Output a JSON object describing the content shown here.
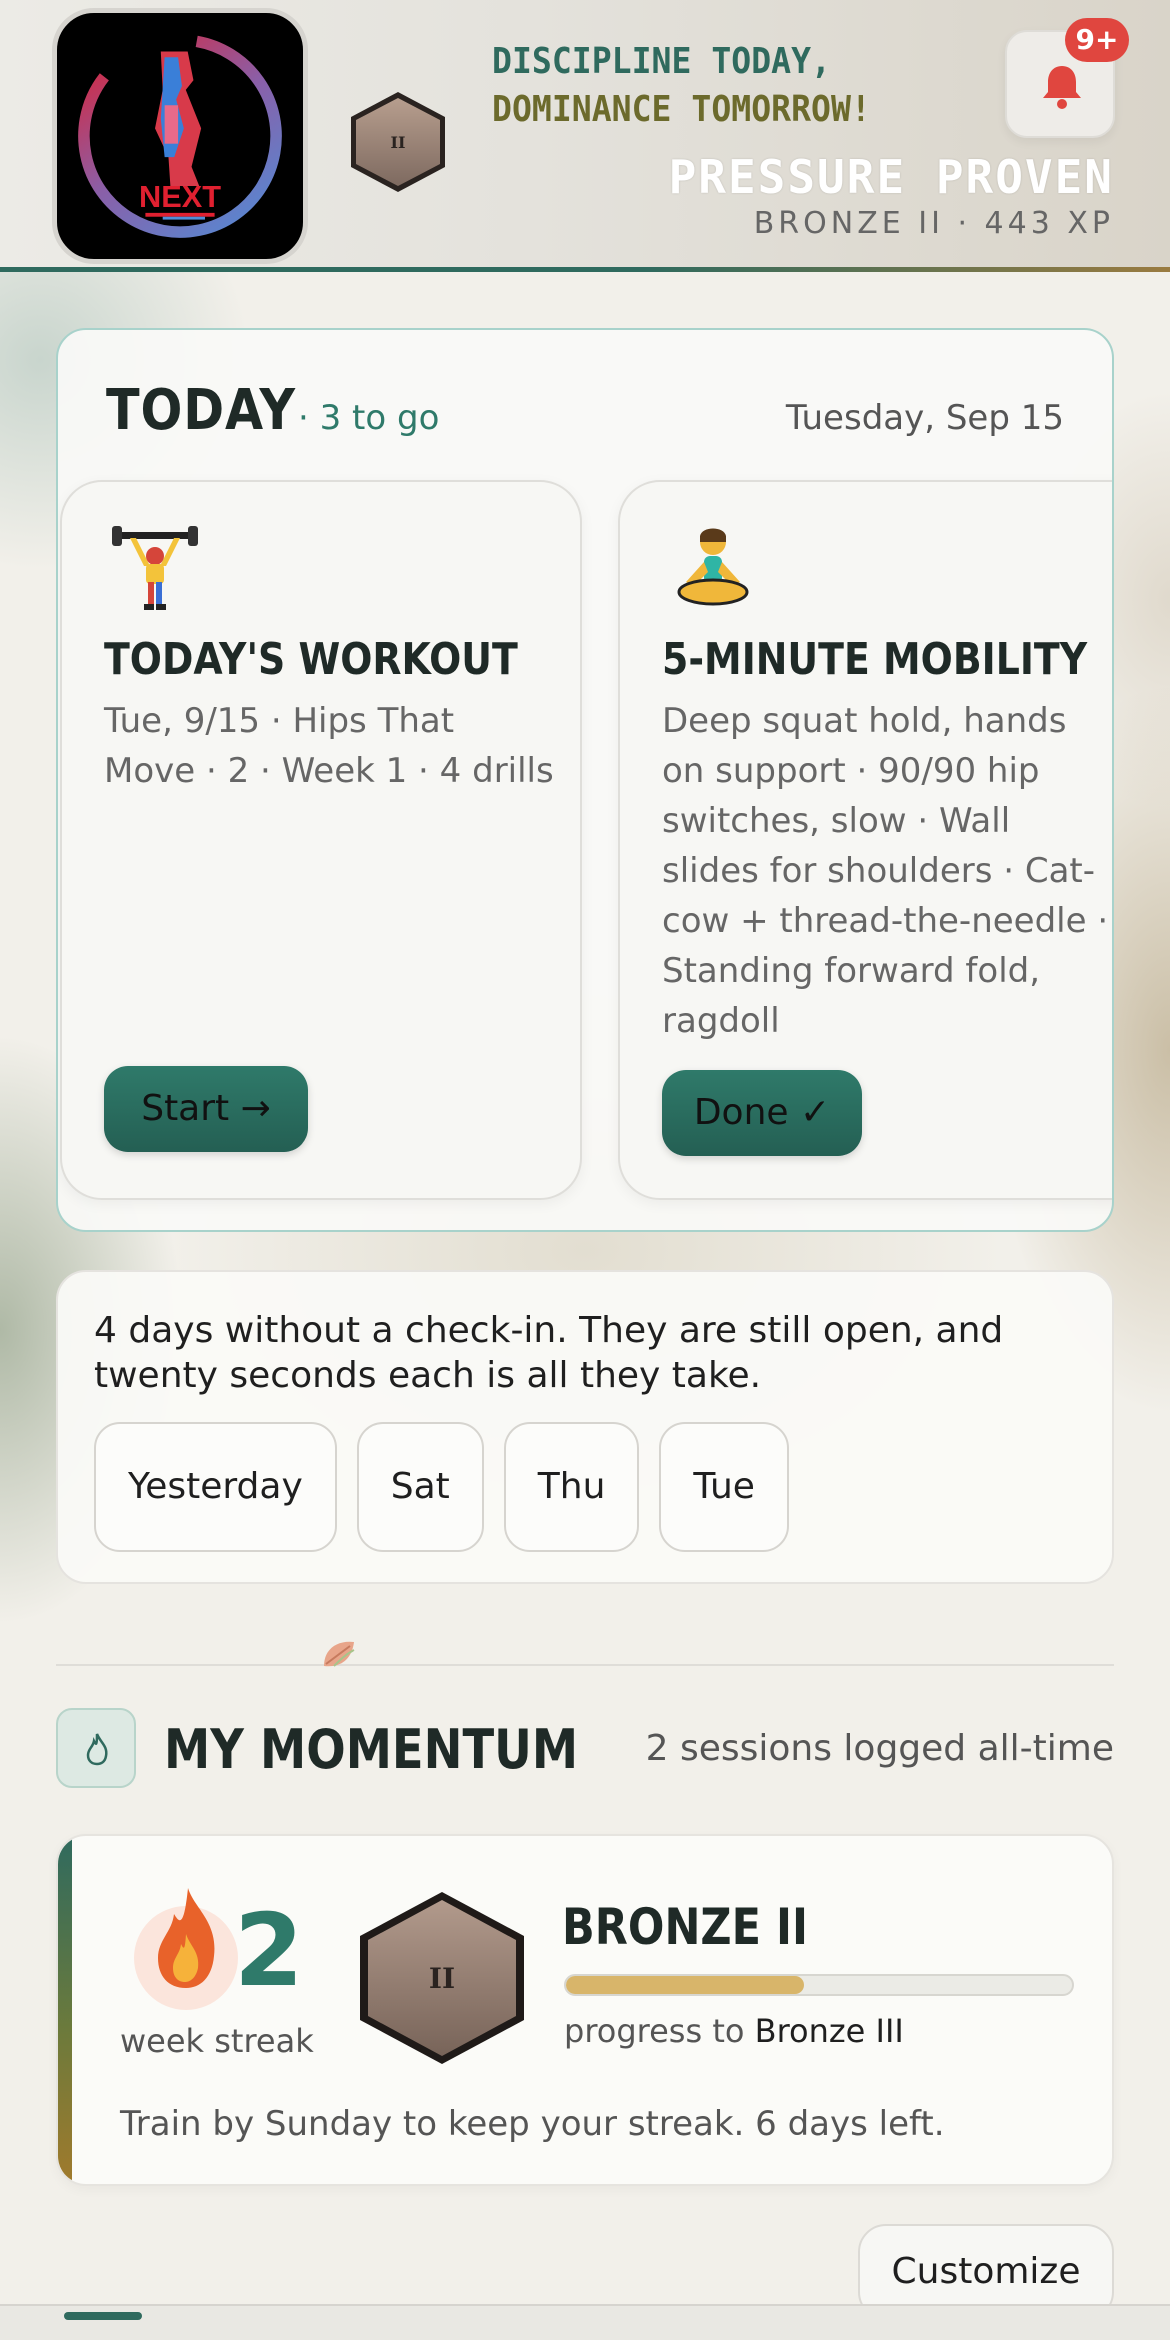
{
  "header": {
    "tagline_line1": "DISCIPLINE TODAY,",
    "tagline_line2": "DOMINANCE TOMORROW!",
    "title": "PRESSURE PROVEN",
    "subtitle": "BRONZE II · 443 XP",
    "notification_badge": "9+",
    "logo_text": "NEXT",
    "rank_numeral": "II"
  },
  "today": {
    "title": "TODAY",
    "remaining": "· 3 to go",
    "date": "Tuesday, Sep 15",
    "tasks": [
      {
        "icon": "weightlifter-icon",
        "title": "TODAY'S WORKOUT",
        "description": "Tue, 9/15 · Hips That Move · 2 · Week 1 · 4 drills",
        "button": "Start →"
      },
      {
        "icon": "lotus-position-icon",
        "title": "5-MINUTE MOBILITY",
        "description": "Deep squat hold, hands on support · 90/90 hip switches, slow · Wall slides for shoulders · Cat-cow + thread-the-needle · Standing forward fold, ragdoll",
        "button": "Done ✓"
      }
    ]
  },
  "checkin": {
    "message": "4 days without a check-in. They are still open, and twenty seconds each is all they take.",
    "days": [
      "Yesterday",
      "Sat",
      "Thu",
      "Tue"
    ]
  },
  "momentum": {
    "title": "MY MOMENTUM",
    "sessions": "2 sessions logged all-time",
    "streak_value": "2",
    "streak_label": "week streak",
    "rank": "BRONZE II",
    "rank_numeral": "II",
    "progress": 0.47,
    "progress_prefix": "progress to ",
    "progress_target": "Bronze III",
    "footer": "Train by Sunday to keep your streak. 6 days left."
  },
  "customize_label": "Customize",
  "colors": {
    "accent": "#2f7a6a",
    "accent_dark": "#245f53",
    "badge_red": "#e0463f",
    "bronze_progress": "#d8b56a"
  }
}
